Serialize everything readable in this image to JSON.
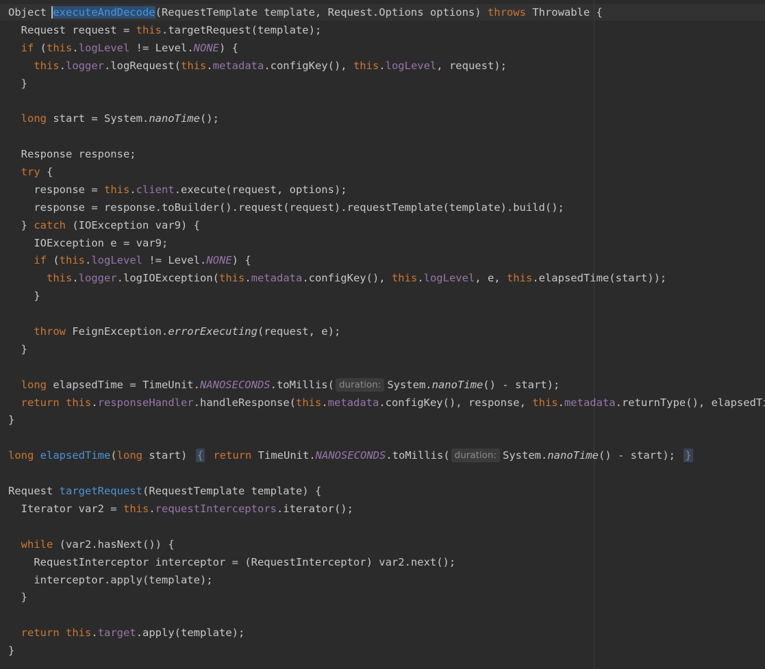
{
  "colors": {
    "background": "#2b2b2b",
    "keyword": "#cc7832",
    "field": "#9876aa",
    "method_declaration": "#4c93d6",
    "plain": "#c8c8c8",
    "inlay_hint": "#8c8c8c",
    "selection": "#2c4e74"
  },
  "code_lines": [
    [
      [
        "t",
        "Object "
      ],
      [
        "s",
        "executeAndDecode"
      ],
      [
        "t",
        "(RequestTemplate template, Request.Options options) "
      ],
      [
        "k",
        "throws"
      ],
      [
        "t",
        " Throwable {"
      ]
    ],
    [
      [
        "t",
        "  Request request = "
      ],
      [
        "k",
        "this"
      ],
      [
        "t",
        "."
      ],
      [
        "t",
        "targetRequest(template);"
      ]
    ],
    [
      [
        "t",
        "  "
      ],
      [
        "k",
        "if"
      ],
      [
        "t",
        " ("
      ],
      [
        "k",
        "this"
      ],
      [
        "t",
        "."
      ],
      [
        "f",
        "logLevel"
      ],
      [
        "t",
        " != Level."
      ],
      [
        "c",
        "NONE"
      ],
      [
        "t",
        ") {"
      ]
    ],
    [
      [
        "t",
        "    "
      ],
      [
        "k",
        "this"
      ],
      [
        "t",
        "."
      ],
      [
        "f",
        "logger"
      ],
      [
        "t",
        ".logRequest("
      ],
      [
        "k",
        "this"
      ],
      [
        "t",
        "."
      ],
      [
        "f",
        "metadata"
      ],
      [
        "t",
        ".configKey(), "
      ],
      [
        "k",
        "this"
      ],
      [
        "t",
        "."
      ],
      [
        "f",
        "logLevel"
      ],
      [
        "t",
        ", request);"
      ]
    ],
    [
      [
        "t",
        "  }"
      ]
    ],
    [],
    [
      [
        "t",
        "  "
      ],
      [
        "k",
        "long"
      ],
      [
        "t",
        " start = System."
      ],
      [
        "i",
        "nanoTime"
      ],
      [
        "t",
        "();"
      ]
    ],
    [],
    [
      [
        "t",
        "  Response response;"
      ]
    ],
    [
      [
        "t",
        "  "
      ],
      [
        "k",
        "try"
      ],
      [
        "t",
        " {"
      ]
    ],
    [
      [
        "t",
        "    response = "
      ],
      [
        "k",
        "this"
      ],
      [
        "t",
        "."
      ],
      [
        "f",
        "client"
      ],
      [
        "t",
        ".execute(request, options);"
      ]
    ],
    [
      [
        "t",
        "    response = response.toBuilder().request(request).requestTemplate(template).build();"
      ]
    ],
    [
      [
        "t",
        "  } "
      ],
      [
        "k",
        "catch"
      ],
      [
        "t",
        " (IOException var9) {"
      ]
    ],
    [
      [
        "t",
        "    IOException e = var9;"
      ]
    ],
    [
      [
        "t",
        "    "
      ],
      [
        "k",
        "if"
      ],
      [
        "t",
        " ("
      ],
      [
        "k",
        "this"
      ],
      [
        "t",
        "."
      ],
      [
        "f",
        "logLevel"
      ],
      [
        "t",
        " != Level."
      ],
      [
        "c",
        "NONE"
      ],
      [
        "t",
        ") {"
      ]
    ],
    [
      [
        "t",
        "      "
      ],
      [
        "k",
        "this"
      ],
      [
        "t",
        "."
      ],
      [
        "f",
        "logger"
      ],
      [
        "t",
        ".logIOException("
      ],
      [
        "k",
        "this"
      ],
      [
        "t",
        "."
      ],
      [
        "f",
        "metadata"
      ],
      [
        "t",
        ".configKey(), "
      ],
      [
        "k",
        "this"
      ],
      [
        "t",
        "."
      ],
      [
        "f",
        "logLevel"
      ],
      [
        "t",
        ", e, "
      ],
      [
        "k",
        "this"
      ],
      [
        "t",
        ".elapsedTime(start));"
      ]
    ],
    [
      [
        "t",
        "    }"
      ]
    ],
    [],
    [
      [
        "t",
        "    "
      ],
      [
        "k",
        "throw"
      ],
      [
        "t",
        " FeignException."
      ],
      [
        "i",
        "errorExecuting"
      ],
      [
        "t",
        "(request, e);"
      ]
    ],
    [
      [
        "t",
        "  }"
      ]
    ],
    [],
    [
      [
        "t",
        "  "
      ],
      [
        "k",
        "long"
      ],
      [
        "t",
        " elapsedTime = TimeUnit."
      ],
      [
        "c",
        "NANOSECONDS"
      ],
      [
        "t",
        ".toMillis("
      ],
      [
        "h",
        "duration:"
      ],
      [
        "t",
        "System."
      ],
      [
        "i",
        "nanoTime"
      ],
      [
        "t",
        "() - start);"
      ]
    ],
    [
      [
        "t",
        "  "
      ],
      [
        "k",
        "return"
      ],
      [
        "t",
        " "
      ],
      [
        "k",
        "this"
      ],
      [
        "t",
        "."
      ],
      [
        "f",
        "responseHandler"
      ],
      [
        "t",
        ".handleResponse("
      ],
      [
        "k",
        "this"
      ],
      [
        "t",
        "."
      ],
      [
        "f",
        "metadata"
      ],
      [
        "t",
        ".configKey(), response, "
      ],
      [
        "k",
        "this"
      ],
      [
        "t",
        "."
      ],
      [
        "f",
        "metadata"
      ],
      [
        "t",
        ".returnType(), elapsedTime);"
      ]
    ],
    [
      [
        "t",
        "}"
      ]
    ],
    [],
    [
      [
        "k",
        "long"
      ],
      [
        "t",
        " "
      ],
      [
        "m",
        "elapsedTime"
      ],
      [
        "t",
        "("
      ],
      [
        "k",
        "long"
      ],
      [
        "t",
        " start) "
      ],
      [
        "o",
        "{"
      ],
      [
        "t",
        " "
      ],
      [
        "k",
        "return"
      ],
      [
        "t",
        " TimeUnit."
      ],
      [
        "c",
        "NANOSECONDS"
      ],
      [
        "t",
        ".toMillis("
      ],
      [
        "h",
        "duration:"
      ],
      [
        "t",
        "System."
      ],
      [
        "i",
        "nanoTime"
      ],
      [
        "t",
        "() - start); "
      ],
      [
        "o",
        "}"
      ]
    ],
    [],
    [
      [
        "t",
        "Request "
      ],
      [
        "m",
        "targetRequest"
      ],
      [
        "t",
        "(RequestTemplate template) {"
      ]
    ],
    [
      [
        "t",
        "  Iterator var2 = "
      ],
      [
        "k",
        "this"
      ],
      [
        "t",
        "."
      ],
      [
        "f",
        "requestInterceptors"
      ],
      [
        "t",
        ".iterator();"
      ]
    ],
    [],
    [
      [
        "t",
        "  "
      ],
      [
        "k",
        "while"
      ],
      [
        "t",
        " (var2.hasNext()) {"
      ]
    ],
    [
      [
        "t",
        "    RequestInterceptor interceptor = (RequestInterceptor) var2.next();"
      ]
    ],
    [
      [
        "t",
        "    interceptor.apply(template);"
      ]
    ],
    [
      [
        "t",
        "  }"
      ]
    ],
    [],
    [
      [
        "t",
        "  "
      ],
      [
        "k",
        "return"
      ],
      [
        "t",
        " "
      ],
      [
        "k",
        "this"
      ],
      [
        "t",
        "."
      ],
      [
        "f",
        "target"
      ],
      [
        "t",
        ".apply(template);"
      ]
    ],
    [
      [
        "t",
        "}"
      ]
    ]
  ]
}
